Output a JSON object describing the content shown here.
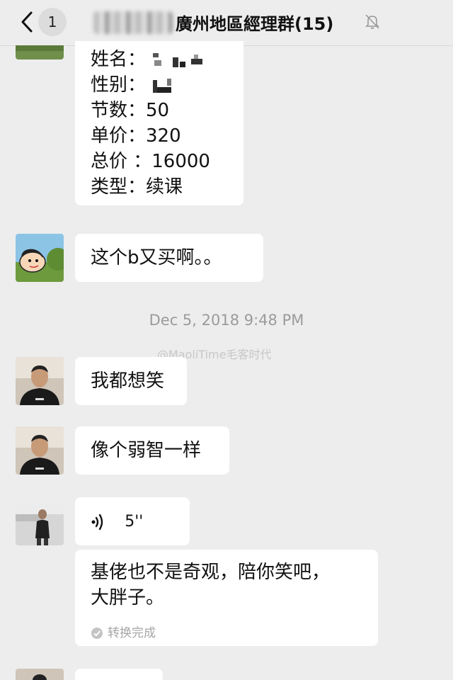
{
  "header": {
    "back_count": "1",
    "group_title": "廣州地區經理群(15)"
  },
  "order_card": {
    "rows": [
      {
        "label": "姓名：",
        "value": ""
      },
      {
        "label": "性别：",
        "value": ""
      },
      {
        "label": "节数：",
        "value": "50"
      },
      {
        "label": "单价：",
        "value": "320"
      },
      {
        "label": "总价 ：",
        "value": "16000"
      },
      {
        "label": "类型：",
        "value": "续课"
      }
    ]
  },
  "messages": {
    "m1": "这个b又买啊。。",
    "timestamp": "Dec 5, 2018 9:48 PM",
    "m2": "我都想笑",
    "m3": "像个弱智一样",
    "voice_duration": "5''",
    "transcript_line1": "基佬也不是奇观，陪你笑吧，",
    "transcript_line2": "大胖子。",
    "convert_status": "转换完成"
  },
  "watermark": "@MaoliTime毛客时代",
  "icons": {
    "back": "chevron-left-icon",
    "mute": "bell-off-icon",
    "voice": "voice-wave-icon",
    "check": "check-circle-icon"
  }
}
